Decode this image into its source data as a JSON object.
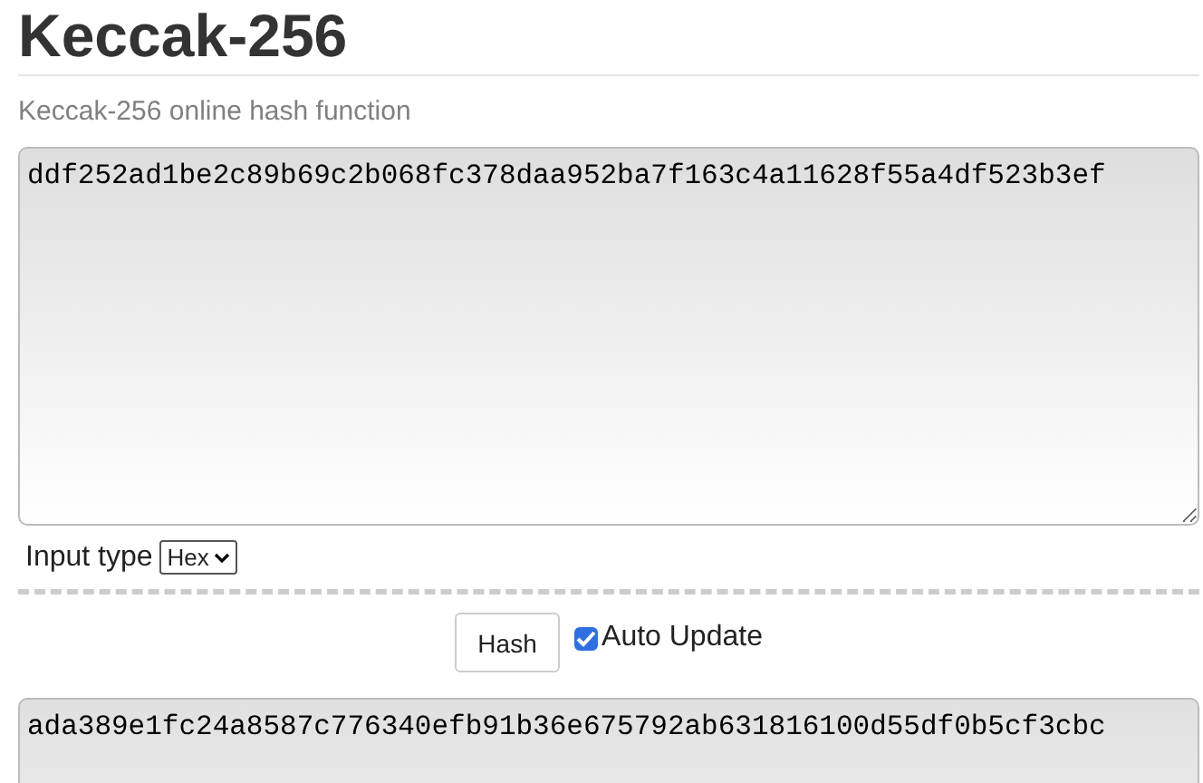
{
  "title": "Keccak-256",
  "subtitle": "Keccak-256 online hash function",
  "input": {
    "value": "ddf252ad1be2c89b69c2b068fc378daa952ba7f163c4a11628f55a4df523b3ef"
  },
  "input_type": {
    "label": "Input type",
    "value": "Hex"
  },
  "hash_button": "Hash",
  "auto_update": {
    "label": "Auto Update",
    "checked": true
  },
  "output": {
    "value": "ada389e1fc24a8587c776340efb91b36e675792ab631816100d55df0b5cf3cbc"
  }
}
